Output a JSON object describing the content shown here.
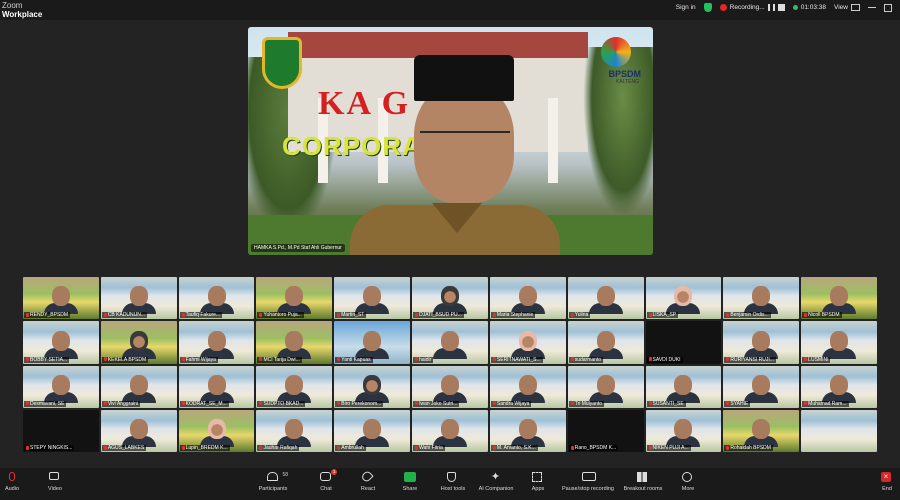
{
  "brand": {
    "line1": "Zoom",
    "line2": "Workplace"
  },
  "topbar": {
    "signin": "Sign in",
    "recording": "Recording...",
    "timer": "01:03:38",
    "view": "View"
  },
  "speaker": {
    "name": "HAMKA S.Pd., M.Pd Staf Ahli Gubernur",
    "banner_word": "KA    G",
    "banner_sub": "CORPORA            RSITY",
    "logo_text": "BPSDM",
    "logo_sub": "KALTENG"
  },
  "gallery": [
    {
      "name": "RENDY_BPSDM",
      "style": "bn",
      "muted": true
    },
    {
      "name": "CB KADUNUN...",
      "style": "",
      "muted": true
    },
    {
      "name": "Taufiq Fakure...",
      "style": "",
      "muted": true
    },
    {
      "name": "Yuhantoro Puja...",
      "style": "bn",
      "muted": true
    },
    {
      "name": "Martin_ST",
      "style": "",
      "muted": true
    },
    {
      "name": "DJATI_BSUD PU...",
      "style": "",
      "muted": true
    },
    {
      "name": "Maria Stephanie",
      "style": "",
      "muted": true
    },
    {
      "name": "Yulina",
      "style": "",
      "muted": true
    },
    {
      "name": "LISKA_SP",
      "style": "",
      "muted": true
    },
    {
      "name": "Benjamin Ordis...",
      "style": "",
      "muted": true
    },
    {
      "name": "Nicoll BPSDM",
      "style": "bn",
      "muted": true
    },
    {
      "name": "BOBBY SETIA...",
      "style": "",
      "muted": true
    },
    {
      "name": "KEKELA BPSDM",
      "style": "bn",
      "muted": true
    },
    {
      "name": "Fahmi Wijaya",
      "style": "",
      "muted": true
    },
    {
      "name": "MCI Tarija Dwi...",
      "style": "bn",
      "muted": true
    },
    {
      "name": "Yanti Kapuas",
      "style": "blue",
      "muted": true
    },
    {
      "name": "haidir",
      "style": "",
      "muted": true
    },
    {
      "name": "SERITNAWATI_S...",
      "style": "",
      "muted": true
    },
    {
      "name": "sudarmanto",
      "style": "",
      "muted": true
    },
    {
      "name": "SAVDI DUKI",
      "style": "dark",
      "muted": true
    },
    {
      "name": "RURIYANSI RUJI...",
      "style": "",
      "muted": true
    },
    {
      "name": "LUSMINI",
      "style": "",
      "muted": true
    },
    {
      "name": "Desmavani, SE",
      "style": "",
      "muted": true
    },
    {
      "name": "Vivi Anggraini",
      "style": "",
      "muted": true
    },
    {
      "name": "KODRAT_SE_M...",
      "style": "",
      "muted": true
    },
    {
      "name": "SUDPTO BKAD...",
      "style": "",
      "muted": true
    },
    {
      "name": "Biro Perekonom...",
      "style": "",
      "muted": true
    },
    {
      "name": "Iwan Joko Sutri...",
      "style": "",
      "muted": true
    },
    {
      "name": "Sandra Wijaya",
      "style": "",
      "muted": true
    },
    {
      "name": "Tri Mulyanto",
      "style": "",
      "muted": true
    },
    {
      "name": "SUSANTI_SE",
      "style": "",
      "muted": true
    },
    {
      "name": "SYAHIE",
      "style": "",
      "muted": true
    },
    {
      "name": "Muhamad Ram...",
      "style": "",
      "muted": true
    },
    {
      "name": "STEPY NINGKIS...",
      "style": "dark",
      "muted": true
    },
    {
      "name": "AGUS_LABKES",
      "style": "",
      "muted": true
    },
    {
      "name": "Lupin_BREDM K...",
      "style": "bn",
      "muted": true
    },
    {
      "name": "Jauhar Rafiqah",
      "style": "",
      "muted": true
    },
    {
      "name": "Ambrullah",
      "style": "",
      "muted": true
    },
    {
      "name": "Wahi Fitria",
      "style": "",
      "muted": true
    },
    {
      "name": "M. Arvanto, S.K...",
      "style": "",
      "muted": true
    },
    {
      "name": "Rano_BPSDM K...",
      "style": "dark",
      "muted": true
    },
    {
      "name": "NIKEN PUJI A...",
      "style": "",
      "muted": true
    },
    {
      "name": "Rohaidah BPSDM",
      "style": "bn",
      "muted": true
    },
    {
      "name": "",
      "style": "",
      "muted": false
    }
  ],
  "toolbar": {
    "audio": "Audio",
    "video": "Video",
    "participants": "Participants",
    "participants_count": "58",
    "chat": "Chat",
    "chat_badge": "1",
    "react": "React",
    "share": "Share",
    "host_tools": "Host tools",
    "ai_companion": "AI Companion",
    "apps": "Apps",
    "pause_recording": "Pause/stop recording",
    "breakout": "Breakout rooms",
    "more": "More",
    "end": "End"
  }
}
